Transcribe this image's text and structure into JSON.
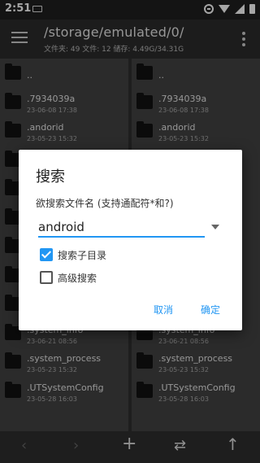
{
  "status_bar": {
    "time": "2:51"
  },
  "app_bar": {
    "path": "/storage/emulated/0/",
    "info": "文件夹: 49  文件: 12  储存: 4.49G/34.31G"
  },
  "left_pane": [
    {
      "name": "..",
      "date": ""
    },
    {
      "name": ".7934039a",
      "date": "23-06-08 17:38"
    },
    {
      "name": ".andorid",
      "date": "23-05-23 15:32"
    },
    {
      "name": "",
      "date": ""
    },
    {
      "name": "",
      "date": ""
    },
    {
      "name": "",
      "date": ""
    },
    {
      "name": "",
      "date": ""
    },
    {
      "name": "",
      "date": ""
    },
    {
      "name": "",
      "date": ""
    },
    {
      "name": ".system_info",
      "date": "23-06-21 08:56"
    },
    {
      "name": ".system_process",
      "date": "23-05-23 15:32"
    },
    {
      "name": ".UTSystemConfig",
      "date": "23-05-28 16:03"
    }
  ],
  "right_pane": [
    {
      "name": "..",
      "date": ""
    },
    {
      "name": ".7934039a",
      "date": "23-06-08 17:38"
    },
    {
      "name": ".andorid",
      "date": "23-05-23 15:32"
    },
    {
      "name": "",
      "date": ""
    },
    {
      "name": "",
      "date": ""
    },
    {
      "name": "",
      "date": ""
    },
    {
      "name": "",
      "date": ""
    },
    {
      "name": "",
      "date": ""
    },
    {
      "name": "",
      "date": ""
    },
    {
      "name": ".system_info",
      "date": "23-06-21 08:56"
    },
    {
      "name": ".system_process",
      "date": "23-05-23 15:32"
    },
    {
      "name": ".UTSystemConfig",
      "date": "23-05-28 16:03"
    }
  ],
  "bottom_bar": {
    "back": "‹",
    "forward": "›",
    "add": "+",
    "swap": "⇄",
    "up": "↑"
  },
  "dialog": {
    "title": "搜索",
    "prompt": "欲搜索文件名 (支持通配符*和?)",
    "input_value": "android",
    "checkbox_subdirs": {
      "label": "搜索子目录",
      "checked": true
    },
    "checkbox_advanced": {
      "label": "高级搜索",
      "checked": false
    },
    "cancel_label": "取消",
    "ok_label": "确定"
  },
  "colors": {
    "accent": "#2196f3",
    "pane_bg": "#424242",
    "appbar_bg": "#2b2b2b"
  }
}
